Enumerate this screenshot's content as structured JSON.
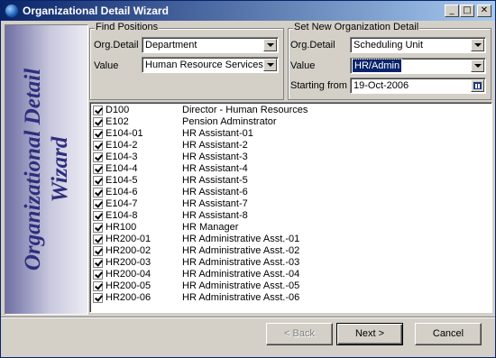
{
  "window": {
    "title": "Organizational Detail Wizard",
    "minimize": "_",
    "maximize": "□",
    "close": "✕"
  },
  "sidebar": {
    "text_line1": "Organizational Detail",
    "text_line2": "Wizard"
  },
  "find_positions": {
    "group_label": "Find Positions",
    "org_detail_label": "Org.Detail",
    "org_detail_value": "Department",
    "value_label": "Value",
    "value_value": "Human Resource Services"
  },
  "set_detail": {
    "group_label": "Set New Organization Detail",
    "org_detail_label": "Org.Detail",
    "org_detail_value": "Scheduling Unit",
    "value_label": "Value",
    "value_value": "HR/Admin",
    "start_label": "Starting from",
    "start_value": "19-Oct-2006"
  },
  "positions": [
    {
      "code": "D100",
      "desc": "Director - Human Resources",
      "checked": true
    },
    {
      "code": "E102",
      "desc": "Pension Adminstrator",
      "checked": true
    },
    {
      "code": "E104-01",
      "desc": "HR Assistant-01",
      "checked": true
    },
    {
      "code": "E104-2",
      "desc": "HR Assistant-2",
      "checked": true
    },
    {
      "code": "E104-3",
      "desc": "HR Assistant-3",
      "checked": true
    },
    {
      "code": "E104-4",
      "desc": "HR Assistant-4",
      "checked": true
    },
    {
      "code": "E104-5",
      "desc": "HR Assistant-5",
      "checked": true
    },
    {
      "code": "E104-6",
      "desc": "HR Assistant-6",
      "checked": true
    },
    {
      "code": "E104-7",
      "desc": "HR Assistant-7",
      "checked": true
    },
    {
      "code": "E104-8",
      "desc": "HR Assistant-8",
      "checked": true
    },
    {
      "code": "HR100",
      "desc": "HR Manager",
      "checked": true
    },
    {
      "code": "HR200-01",
      "desc": "HR Administrative Asst.-01",
      "checked": true
    },
    {
      "code": "HR200-02",
      "desc": "HR Administrative Asst.-02",
      "checked": true
    },
    {
      "code": "HR200-03",
      "desc": "HR Administrative Asst.-03",
      "checked": true
    },
    {
      "code": "HR200-04",
      "desc": "HR Administrative Asst.-04",
      "checked": true
    },
    {
      "code": "HR200-05",
      "desc": "HR Administrative Asst.-05",
      "checked": true
    },
    {
      "code": "HR200-06",
      "desc": "HR Administrative Asst.-06",
      "checked": true
    }
  ],
  "buttons": {
    "back": "< Back",
    "next": "Next >",
    "cancel": "Cancel"
  },
  "colors": {
    "titlebar_start": "#0a246a",
    "titlebar_end": "#a6caf0",
    "selection": "#0a246a",
    "sidebar_text": "#2e2e7e"
  }
}
